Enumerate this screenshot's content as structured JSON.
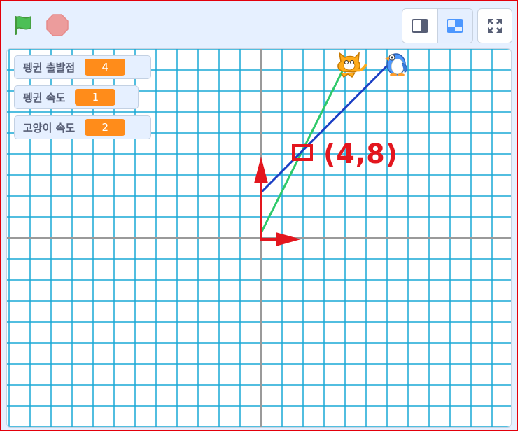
{
  "toolbar": {
    "green_flag_icon": "green-flag-icon",
    "stop_icon": "stop-icon",
    "small_stage_icon": "small-stage-icon",
    "normal_stage_icon": "normal-stage-icon",
    "fullscreen_icon": "fullscreen-icon"
  },
  "monitors": [
    {
      "label": "펭귄 출발점",
      "value": "4"
    },
    {
      "label": "펭귄 속도",
      "value": "1"
    },
    {
      "label": "고양이 속도",
      "value": "2"
    }
  ],
  "annotation": {
    "text": "(4,8)",
    "color": "#e3161e"
  },
  "stage": {
    "grid_color": "#19a9d6",
    "axis_color": "#999999",
    "cat_line_color": "#2fc96a",
    "penguin_line_color": "#1b3fc4",
    "sprites": [
      "cat-sprite",
      "penguin-sprite"
    ]
  }
}
